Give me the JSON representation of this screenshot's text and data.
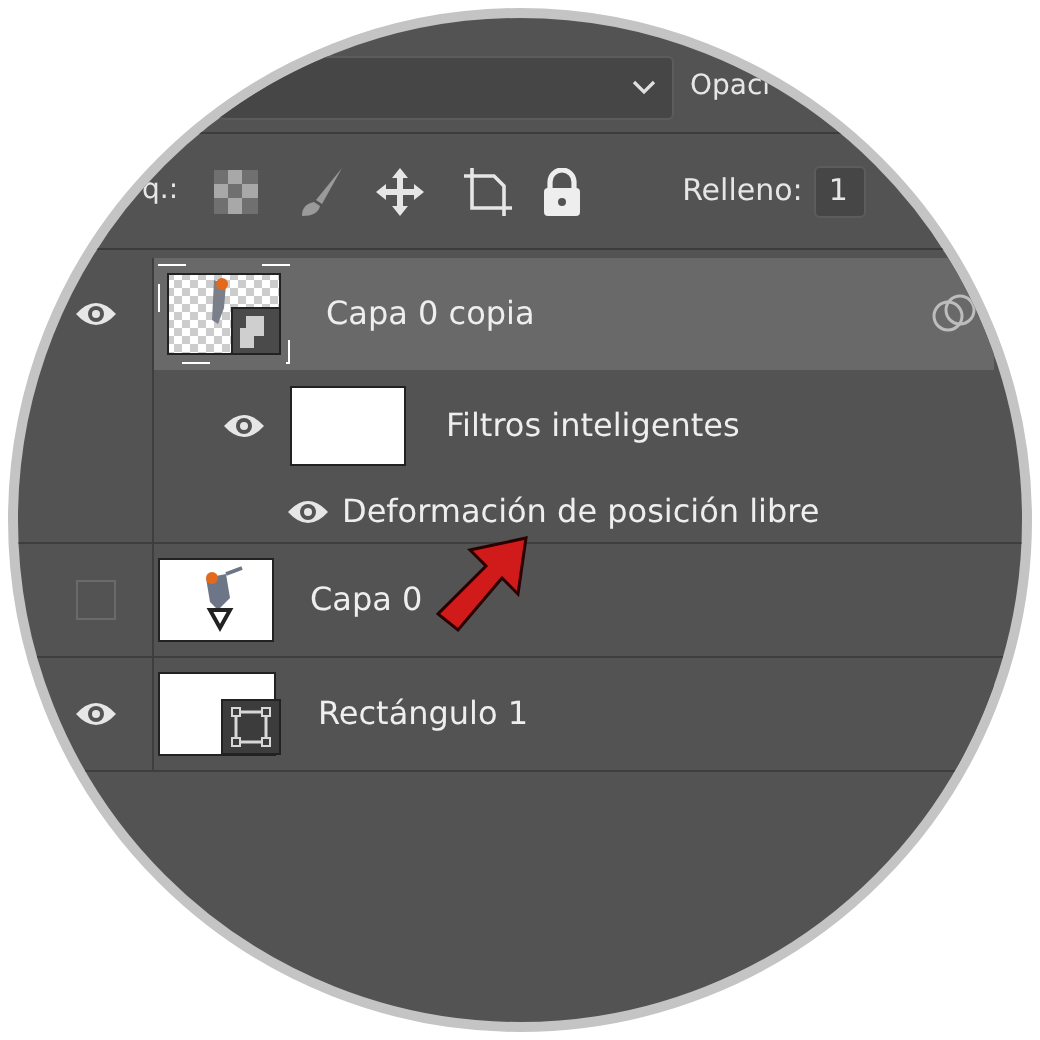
{
  "toolbar": {
    "opacity_label": "Opaci"
  },
  "lock_row": {
    "label": "q.:",
    "fill_label": "Relleno:",
    "fill_value": "1"
  },
  "layers": [
    {
      "name": "Capa 0 copia",
      "kind": "smart",
      "visible": true,
      "selected": true,
      "children": [
        {
          "name": "Filtros inteligentes",
          "kind": "filter_mask",
          "visible": true,
          "children": [
            {
              "name": "Deformación de posición libre",
              "kind": "filter",
              "visible": true
            }
          ]
        }
      ]
    },
    {
      "name": "Capa 0",
      "visible": false,
      "selected": false
    },
    {
      "name": "Rectángulo 1",
      "kind": "shape",
      "visible": true,
      "selected": false
    }
  ]
}
